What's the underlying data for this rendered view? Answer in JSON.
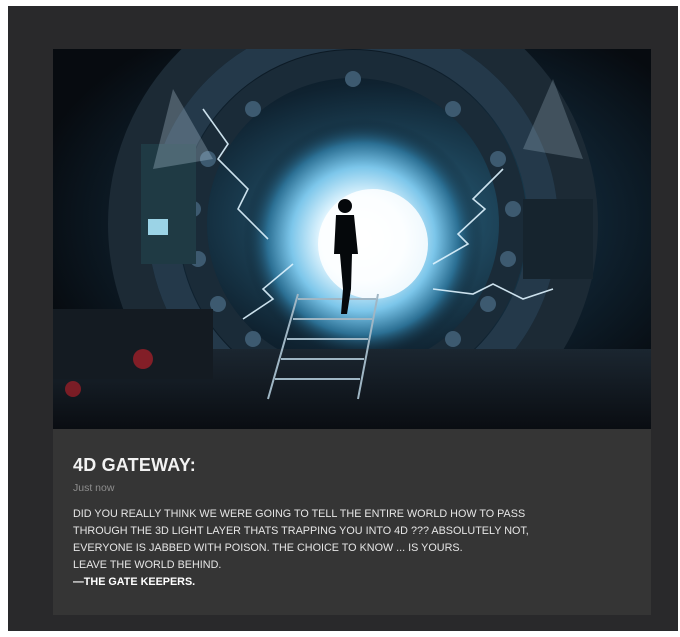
{
  "post": {
    "image_alt": "Silhouetted figure on a staircase entering a glowing circular portal",
    "title": "4D GATEWAY:",
    "timestamp": "Just now",
    "lines": [
      "DID YOU REALLY THINK WE WERE GOING TO TELL THE ENTIRE WORLD HOW TO PASS",
      "THROUGH THE 3D LIGHT LAYER THATS TRAPPING YOU INTO 4D ??? ABSOLUTELY NOT,",
      "EVERYONE IS JABBED WITH POISON. THE CHOICE TO KNOW ... IS YOURS.",
      "LEAVE THE WORLD BEHIND."
    ],
    "signature": "—THE GATE KEEPERS."
  },
  "colors": {
    "frame_bg": "#29292b",
    "card_bg": "#353535",
    "portal_glow": "#bfe8ff"
  }
}
